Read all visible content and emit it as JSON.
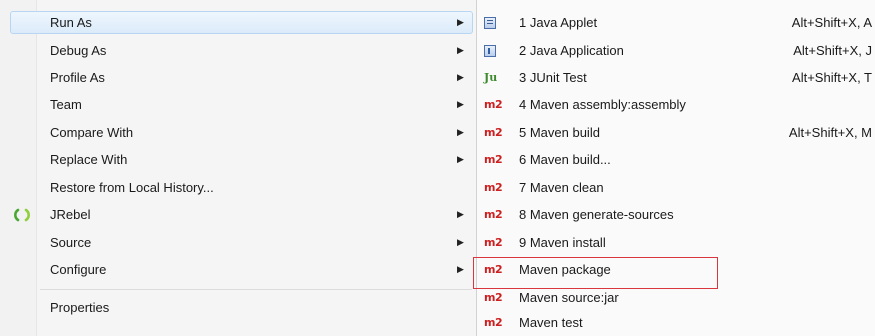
{
  "left_menu": {
    "items": [
      {
        "label": "Run As",
        "has_submenu": true,
        "selected": true
      },
      {
        "label": "Debug As",
        "has_submenu": true
      },
      {
        "label": "Profile As",
        "has_submenu": true
      },
      {
        "label": "Team",
        "has_submenu": true
      },
      {
        "label": "Compare With",
        "has_submenu": true
      },
      {
        "label": "Replace With",
        "has_submenu": true
      },
      {
        "label": "Restore from Local History...",
        "has_submenu": false
      },
      {
        "label": "JRebel",
        "has_submenu": true,
        "icon": "jrebel-icon"
      },
      {
        "label": "Source",
        "has_submenu": true
      },
      {
        "label": "Configure",
        "has_submenu": true
      },
      {
        "label": "Properties",
        "has_submenu": false
      }
    ],
    "arrow_glyph": "▶"
  },
  "submenu": {
    "items": [
      {
        "icon": "java-applet-icon",
        "label": "1 Java Applet",
        "shortcut": "Alt+Shift+X, A"
      },
      {
        "icon": "java-application-icon",
        "label": "2 Java Application",
        "shortcut": "Alt+Shift+X, J"
      },
      {
        "icon": "junit-icon",
        "icon_text": "Ju",
        "label": "3 JUnit Test",
        "shortcut": "Alt+Shift+X, T"
      },
      {
        "icon": "maven-icon",
        "icon_text": "m2",
        "label": "4 Maven assembly:assembly",
        "shortcut": ""
      },
      {
        "icon": "maven-icon",
        "icon_text": "m2",
        "label": "5 Maven build",
        "shortcut": "Alt+Shift+X, M"
      },
      {
        "icon": "maven-icon",
        "icon_text": "m2",
        "label": "6 Maven build...",
        "shortcut": ""
      },
      {
        "icon": "maven-icon",
        "icon_text": "m2",
        "label": "7 Maven clean",
        "shortcut": ""
      },
      {
        "icon": "maven-icon",
        "icon_text": "m2",
        "label": "8 Maven generate-sources",
        "shortcut": ""
      },
      {
        "icon": "maven-icon",
        "icon_text": "m2",
        "label": "9 Maven install",
        "shortcut": ""
      },
      {
        "icon": "maven-icon",
        "icon_text": "m2",
        "label": "Maven package",
        "shortcut": "",
        "annotated": true
      },
      {
        "icon": "maven-icon",
        "icon_text": "m2",
        "label": "Maven source:jar",
        "shortcut": ""
      },
      {
        "icon": "maven-icon",
        "icon_text": "m2",
        "label": "Maven test",
        "shortcut": ""
      }
    ]
  },
  "colors": {
    "selection_border": "#b8d6f2",
    "maven_icon": "#cc1f1f",
    "junit_icon": "#3f8a2f",
    "annotation_box": "#d9363e"
  }
}
